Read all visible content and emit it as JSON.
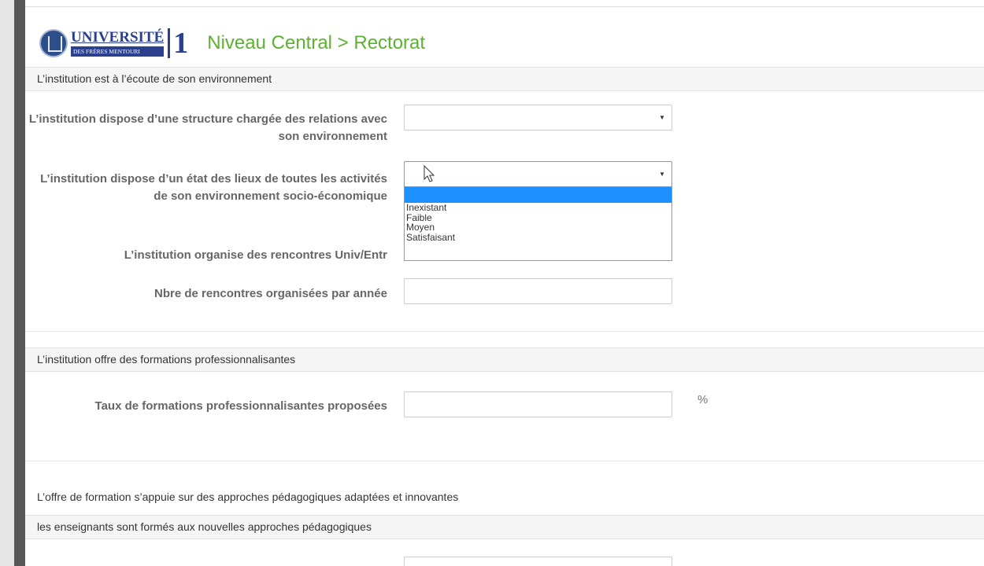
{
  "header": {
    "logo": {
      "word": "UNIVERSITÉ",
      "sub": "DES FRÈRES MENTOURI",
      "num": "1"
    },
    "title": "Niveau Central > Rectorat"
  },
  "section1": {
    "title": "L’institution est à l’écoute de son environnement",
    "q1": {
      "label": "L’institution dispose d’une structure chargée des relations avec son environnement",
      "value": ""
    },
    "q2": {
      "label": "L’institution dispose d’un état des lieux de toutes les activités de son environnement socio-économique",
      "value": "",
      "options": [
        "",
        "Inexistant",
        "Faible",
        "Moyen",
        "Satisfaisant"
      ]
    },
    "q3": {
      "label": "L’institution organise des rencontres Univ/Entr"
    },
    "q4": {
      "label": "Nbre de rencontres organisées par année",
      "value": ""
    }
  },
  "section2": {
    "title": "L’institution offre des formations professionnalisantes",
    "q1": {
      "label": "Taux de formations professionnalisantes proposées",
      "value": "",
      "unit": "%"
    }
  },
  "section3": {
    "title": "L’offre de formation s’appuie sur des approches pédagogiques adaptées et innovantes",
    "subtitle": "les enseignants sont formés aux nouvelles approches pédagogiques"
  },
  "colors": {
    "title_green": "#5cb230",
    "logo_blue": "#2a3f8d",
    "highlight": "#1e90ff",
    "label_gray": "#666666"
  },
  "icons": [
    "university-logo-icon",
    "caret-down-icon",
    "mouse-pointer-icon"
  ]
}
